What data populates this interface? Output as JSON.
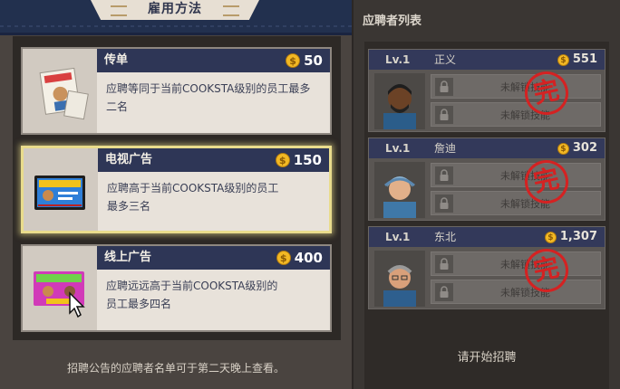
{
  "left": {
    "title": "雇用方法",
    "footer": "招聘公告的应聘者名单可于第二天晚上查看。",
    "methods": [
      {
        "name": "传单",
        "price": "50",
        "desc": "应聘等同于当前COOKSTA级别的员工最多二名",
        "selected": false,
        "image": "flyer-image"
      },
      {
        "name": "电视广告",
        "price": "150",
        "desc": "应聘高于当前COOKSTA级别的员工最多三名",
        "selected": true,
        "image": "tv-ad-image"
      },
      {
        "name": "线上广告",
        "price": "400",
        "desc": "应聘远远高于当前COOKSTA级别的员工最多四名",
        "selected": false,
        "image": "online-ad-image"
      }
    ]
  },
  "right": {
    "title": "应聘者列表",
    "start_text": "请开始招聘",
    "stamp_text": "完",
    "applicants": [
      {
        "level": "Lv.1",
        "name": "正义",
        "cost": "551",
        "skills": [
          "未解锁技能",
          "未解锁技能"
        ]
      },
      {
        "level": "Lv.1",
        "name": "詹迪",
        "cost": "302",
        "skills": [
          "未解锁技能",
          "未解锁技能"
        ]
      },
      {
        "level": "Lv.1",
        "name": "东北",
        "cost": "1,307",
        "skills": [
          "未解锁技能",
          "未解锁技能"
        ]
      }
    ]
  },
  "icons": {
    "coin": "coin-icon",
    "lock": "lock-icon",
    "cursor": "mouse-pointer-icon"
  },
  "colors": {
    "accent_selected": "#e9dc8c",
    "header_navy": "#2e3656",
    "stamp_red": "#d42222",
    "coin_gold": "#f2b824"
  }
}
